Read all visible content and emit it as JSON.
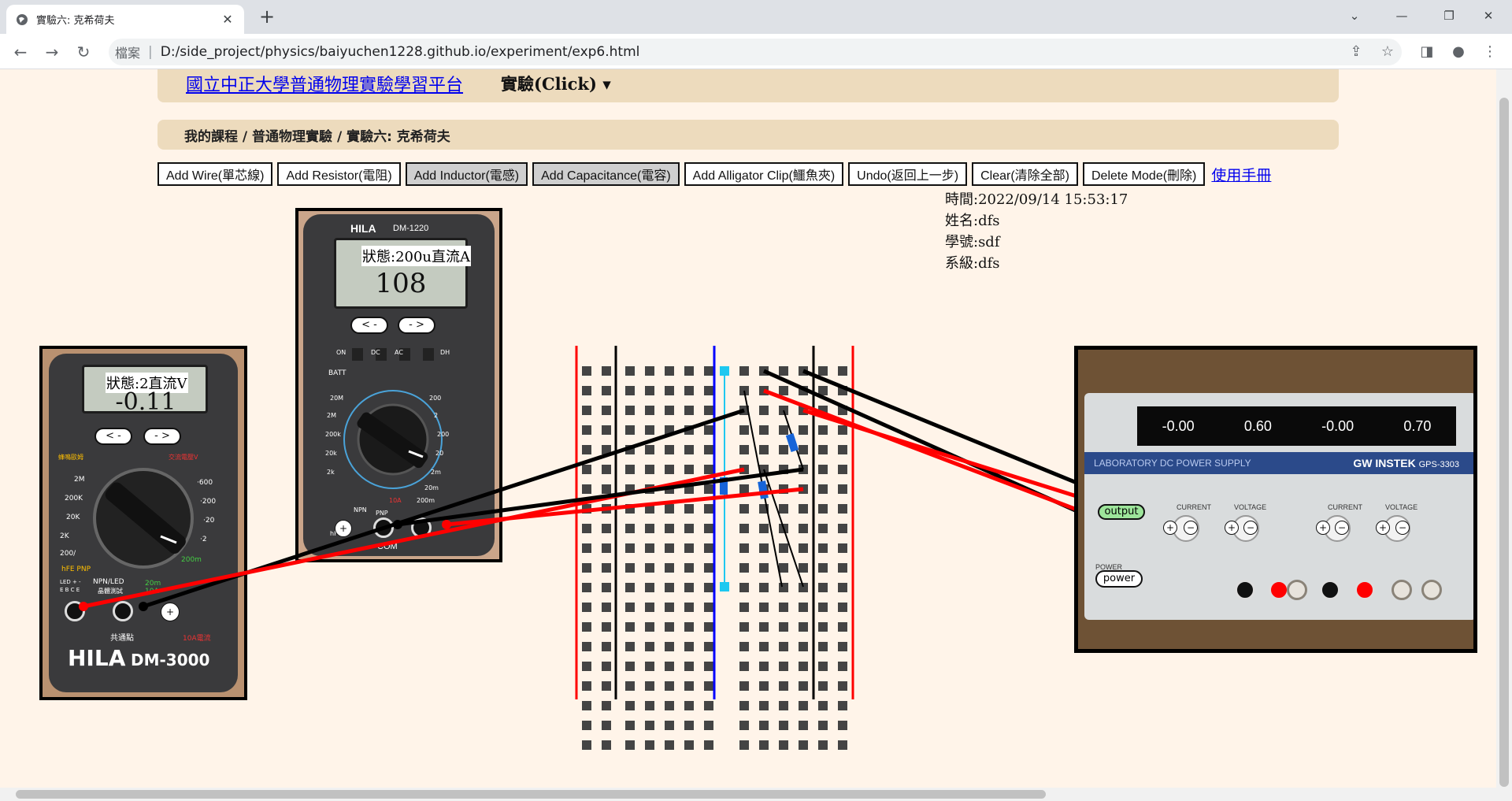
{
  "browser": {
    "tab_title": "實驗六: 克希荷夫",
    "omnibox_scheme": "檔案",
    "url": "D:/side_project/physics/baiyuchen1228.github.io/experiment/exp6.html"
  },
  "navbar": {
    "brand": "國立中正大學普通物理實驗學習平台",
    "menu": "實驗(Click) ▾"
  },
  "breadcrumb": "我的課程 / 普通物理實驗 / 實驗六: 克希荷夫",
  "toolbar": {
    "buttons": [
      "Add Wire(單芯線)",
      "Add Resistor(電阻)",
      "Add Inductor(電感)",
      "Add Capacitance(電容)",
      "Add Alligator Clip(鱷魚夾)",
      "Undo(返回上一步)",
      "Clear(清除全部)",
      "Delete Mode(刪除)"
    ],
    "manual": "使用手冊"
  },
  "info": {
    "time": "時間:2022/09/14 15:53:17",
    "name": "姓名:dfs",
    "student_id": "學號:sdf",
    "department": "系級:dfs"
  },
  "meter_small": {
    "brand": "HILA",
    "model": "DM-3000",
    "state": "狀態:2直流V",
    "reading": "-0.11",
    "prev": "< -",
    "next": "- >"
  },
  "meter_large": {
    "brand": "HILA",
    "model": "DM-1220",
    "state": "狀態:200u直流A",
    "reading": "108",
    "prev": "< -",
    "next": "- >"
  },
  "power_supply": {
    "brand": "GW INSTEK",
    "model": "GPS-3303",
    "band_label": "LABORATORY DC POWER SUPPLY",
    "displays": [
      "-0.00",
      "0.60",
      "-0.00",
      "0.70"
    ],
    "output_button": "output",
    "power_button": "power",
    "labels": {
      "current": "CURRENT",
      "voltage": "VOLTAGE",
      "power": "POWER"
    }
  },
  "colors": {
    "page_bg": "#fff4e9",
    "nav_bg": "#eddbbd",
    "wire_red": "#ff0000",
    "wire_black": "#000000",
    "rail_red": "#ff0000",
    "rail_blue": "#0000ff"
  }
}
